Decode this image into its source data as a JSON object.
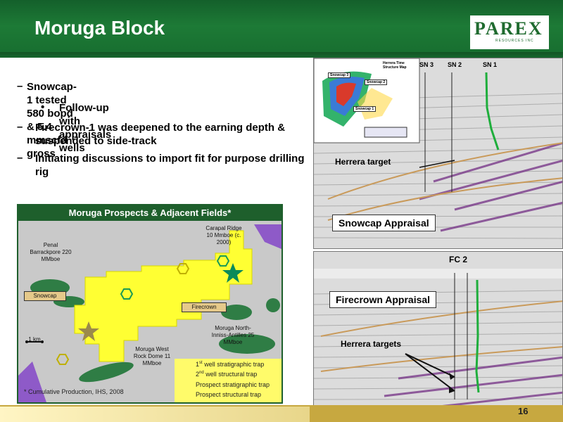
{
  "slide": {
    "title": "Moruga Block",
    "page_number": "16"
  },
  "logo": {
    "text": "PAREX",
    "subtext": "RESOURCES INC"
  },
  "bullets": [
    {
      "marker": "–",
      "text": "Snowcap-1 tested 580 bopd & 5.4 mmscfd gross"
    },
    {
      "marker": "•",
      "text": "Follow-up with appraisals wells"
    },
    {
      "marker": "–",
      "text": "Firecrown-1 was deepened to the earning depth & suspended to side-track"
    },
    {
      "marker": "–",
      "text": "Initiating discussions to import  fit for purpose drilling rig"
    }
  ],
  "map": {
    "title": "Moruga Prospects & Adjacent Fields*",
    "labels": {
      "penal": "Penal Barrackpore 220 MMboe",
      "carapal": "Carapal Ridge 10 Mmboe (c. 2000)",
      "snowcap": "Snowcap",
      "firecrown": "Firecrown",
      "moruga_north": "Moruga North-Inniss-Antilles 25 MMboe",
      "moruga_west": "Moruga West Rock Dome 11 MMboe",
      "scale": "1 km"
    },
    "legend": [
      {
        "icon": "green-star",
        "sup": "st",
        "num": "1",
        "text": "well stratigraphic trap"
      },
      {
        "icon": "brown-star",
        "sup": "nd",
        "num": "2",
        "text": "well structural trap"
      },
      {
        "icon": "green-hexagon",
        "text": "Prospect stratigraphic trap"
      },
      {
        "icon": "yellow-hexagon",
        "text": "Prospect structural trap"
      }
    ],
    "footnote": "* Cumulative Production, IHS, 2008"
  },
  "snowcap_panel": {
    "label": "Snowcap Appraisal",
    "target": "Herrera target",
    "wells": [
      "SN 3",
      "SN 2",
      "SN 1"
    ],
    "inset": {
      "title": "Herrera Time Structure Map",
      "labels": [
        "Snowcap 3",
        "Snowcap 2",
        "Snowcap 1"
      ]
    }
  },
  "firecrown_panel": {
    "label": "Firecrown Appraisal",
    "target": "Herrera targets",
    "well": "FC 2"
  },
  "colors": {
    "header_green": "#1d7a36",
    "map_border": "#1e5f2c",
    "field_yellow": "#ffff33",
    "field_green": "#2f7d45",
    "footer_gold": "#c7a840"
  }
}
